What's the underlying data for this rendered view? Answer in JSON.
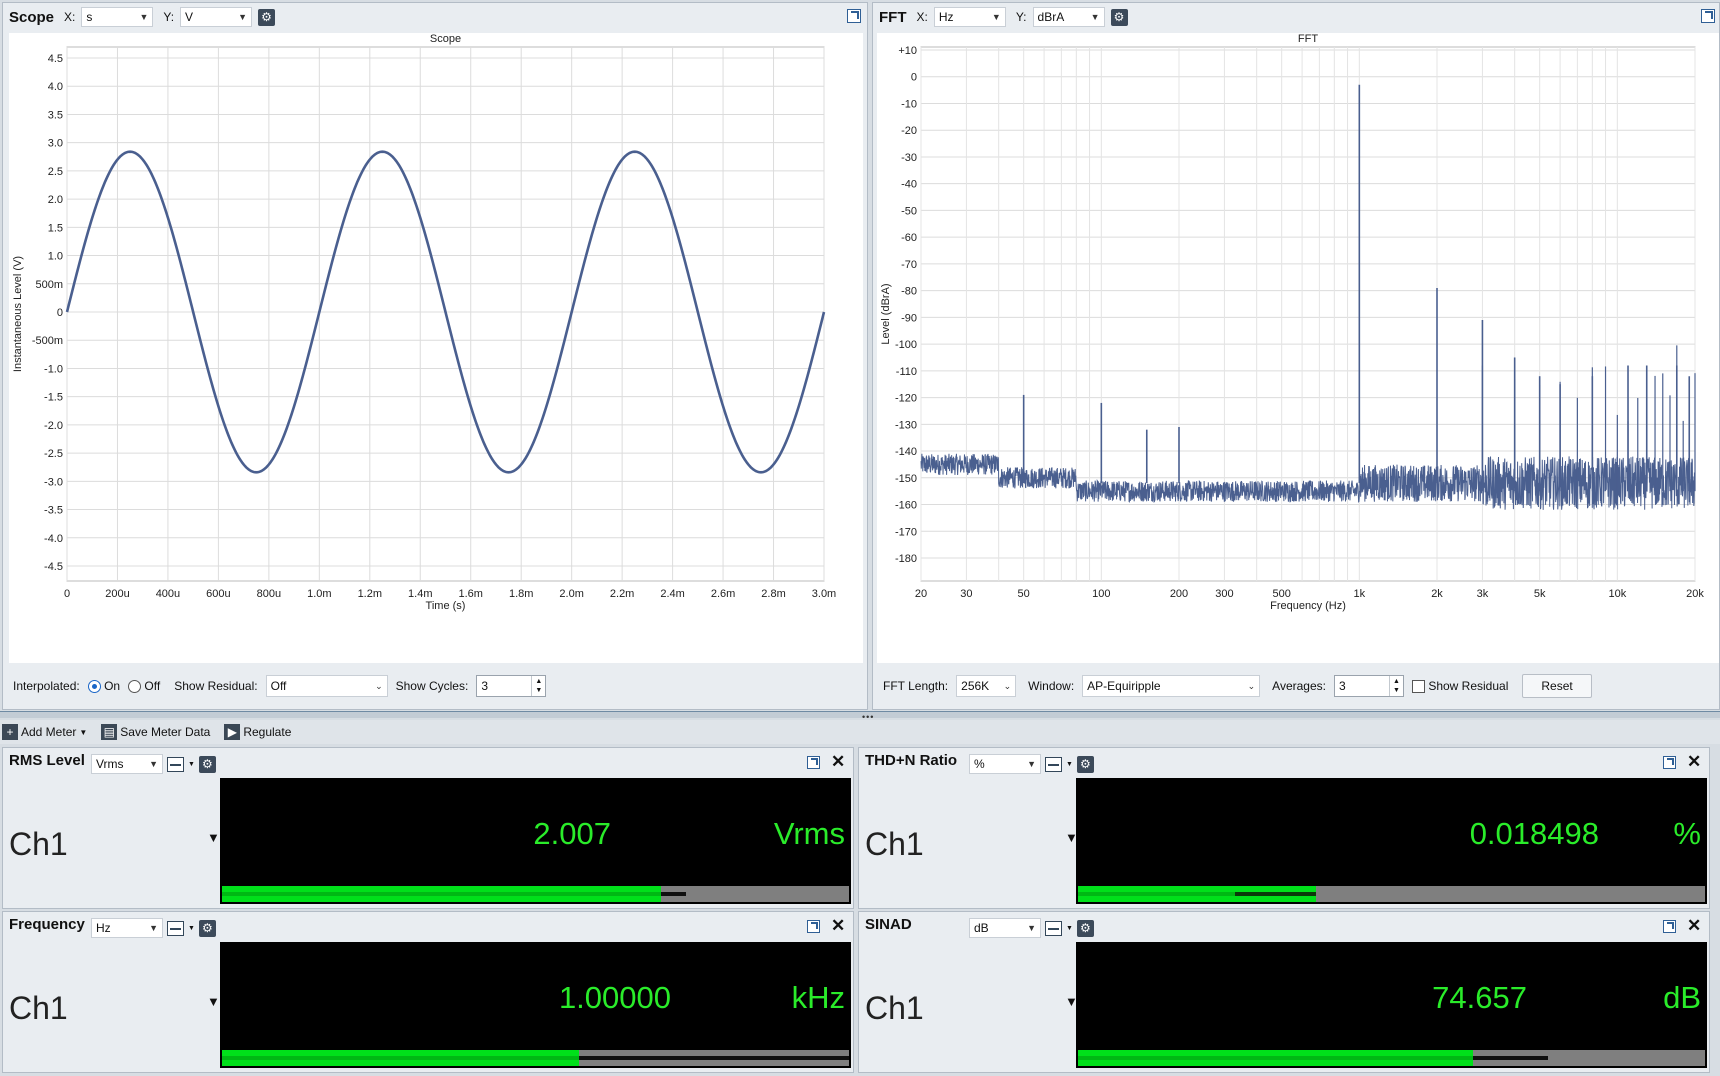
{
  "scope": {
    "title": "Scope",
    "x_label_prefix": "X:",
    "x_unit": "s",
    "y_label_prefix": "Y:",
    "y_unit": "V",
    "plot_title": "Scope",
    "x_axis_title": "Time (s)",
    "y_axis_title": "Instantaneous Level (V)",
    "y_ticks": [
      "4.5",
      "4.0",
      "3.5",
      "3.0",
      "2.5",
      "2.0",
      "1.5",
      "1.0",
      "500m",
      "0",
      "-500m",
      "-1.0",
      "-1.5",
      "-2.0",
      "-2.5",
      "-3.0",
      "-3.5",
      "-4.0",
      "-4.5"
    ],
    "x_ticks": [
      "0",
      "200u",
      "400u",
      "600u",
      "800u",
      "1.0m",
      "1.2m",
      "1.4m",
      "1.6m",
      "1.8m",
      "2.0m",
      "2.2m",
      "2.4m",
      "2.6m",
      "2.8m",
      "3.0m"
    ],
    "controls": {
      "interpolated_label": "Interpolated:",
      "on_label": "On",
      "off_label": "Off",
      "interpolated_value": "On",
      "show_residual_label": "Show Residual:",
      "show_residual_value": "Off",
      "show_cycles_label": "Show Cycles:",
      "show_cycles_value": "3"
    }
  },
  "fft": {
    "title": "FFT",
    "x_label_prefix": "X:",
    "x_unit": "Hz",
    "y_label_prefix": "Y:",
    "y_unit": "dBrA",
    "plot_title": "FFT",
    "x_axis_title": "Frequency (Hz)",
    "y_axis_title": "Level (dBrA)",
    "y_ticks": [
      "+10",
      "0",
      "-10",
      "-20",
      "-30",
      "-40",
      "-50",
      "-60",
      "-70",
      "-80",
      "-90",
      "-100",
      "-110",
      "-120",
      "-130",
      "-140",
      "-150",
      "-160",
      "-170",
      "-180"
    ],
    "x_ticks": [
      "20",
      "30",
      "50",
      "100",
      "200",
      "300",
      "500",
      "1k",
      "2k",
      "3k",
      "5k",
      "10k",
      "20k"
    ],
    "controls": {
      "fft_length_label": "FFT Length:",
      "fft_length_value": "256K",
      "window_label": "Window:",
      "window_value": "AP-Equiripple",
      "averages_label": "Averages:",
      "averages_value": "3",
      "show_residual_label": "Show Residual",
      "reset_label": "Reset"
    }
  },
  "toolbar": {
    "add_meter": "Add Meter",
    "save_meter_data": "Save Meter Data",
    "regulate": "Regulate"
  },
  "meters": {
    "rms": {
      "title": "RMS Level",
      "unit_select": "Vrms",
      "channel": "Ch1",
      "value": "2.007",
      "unit": "Vrms",
      "bar_level_pct": 70,
      "peak_pct": 74
    },
    "thd": {
      "title": "THD+N Ratio",
      "unit_select": "%",
      "channel": "Ch1",
      "value": "0.018498",
      "unit": "%",
      "bar_level_pct": 38,
      "peak_pct": 25
    },
    "freq": {
      "title": "Frequency",
      "unit_select": "Hz",
      "channel": "Ch1",
      "value": "1.00000",
      "unit": "kHz",
      "bar_level_pct": 57,
      "peak_pct": 100
    },
    "sinad": {
      "title": "SINAD",
      "unit_select": "dB",
      "channel": "Ch1",
      "value": "74.657",
      "unit": "dB",
      "bar_level_pct": 63,
      "peak_pct": 75
    }
  },
  "chart_data": [
    {
      "type": "line",
      "title": "Scope",
      "xlabel": "Time (s)",
      "ylabel": "Instantaneous Level (V)",
      "xlim": [
        0,
        0.003
      ],
      "ylim": [
        -4.5,
        4.5
      ],
      "series": [
        {
          "frequency_hz": 1000,
          "amplitude_v": 2.84,
          "phase": 0
        }
      ],
      "grid": true
    },
    {
      "type": "line",
      "title": "FFT",
      "xlabel": "Frequency (Hz)",
      "ylabel": "Level (dBrA)",
      "xscale": "log",
      "xlim": [
        20,
        20000
      ],
      "ylim": [
        -185,
        10
      ],
      "noise_floor_db": -153,
      "peaks": [
        {
          "x": 50,
          "y": -119
        },
        {
          "x": 100,
          "y": -122
        },
        {
          "x": 150,
          "y": -132
        },
        {
          "x": 200,
          "y": -131
        },
        {
          "x": 1000,
          "y": -3
        },
        {
          "x": 2000,
          "y": -79
        },
        {
          "x": 3000,
          "y": -91
        },
        {
          "x": 4000,
          "y": -105
        },
        {
          "x": 5000,
          "y": -112
        },
        {
          "x": 6000,
          "y": -115
        },
        {
          "x": 8000,
          "y": -112
        },
        {
          "x": 11000,
          "y": -108
        },
        {
          "x": 13000,
          "y": -108
        },
        {
          "x": 17000,
          "y": -108
        },
        {
          "x": 19000,
          "y": -112
        }
      ],
      "grid": true
    }
  ]
}
